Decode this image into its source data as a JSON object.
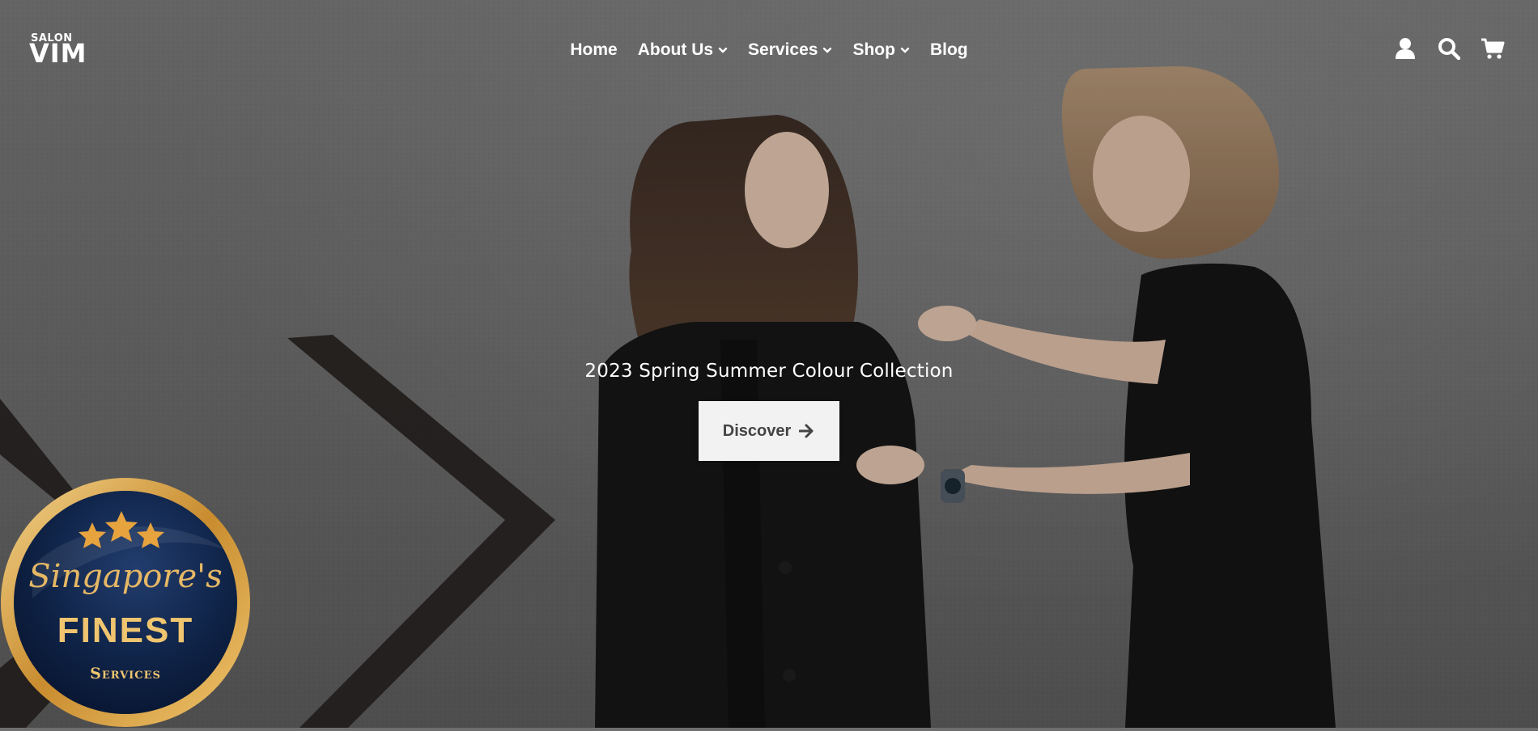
{
  "brand": {
    "top_text": "SALON",
    "main_text": "VIM"
  },
  "nav": {
    "items": [
      {
        "label": "Home",
        "has_dropdown": false
      },
      {
        "label": "About Us",
        "has_dropdown": true
      },
      {
        "label": "Services",
        "has_dropdown": true
      },
      {
        "label": "Shop",
        "has_dropdown": true
      },
      {
        "label": "Blog",
        "has_dropdown": false
      }
    ]
  },
  "header_icons": {
    "account": "user-icon",
    "search": "search-icon",
    "cart": "cart-icon"
  },
  "hero": {
    "title": "2023 Spring Summer Colour Collection",
    "cta_label": "Discover",
    "cta_icon": "arrow-right-icon"
  },
  "badge": {
    "line1": "Singapore's",
    "line2": "FINEST",
    "line3": "Services",
    "stars": 3
  },
  "colors": {
    "text": "#ffffff",
    "button_bg": "#f2f2f2",
    "button_text": "#444444",
    "badge_gold": "#d4a04a",
    "badge_navy": "#0d1f3f"
  }
}
